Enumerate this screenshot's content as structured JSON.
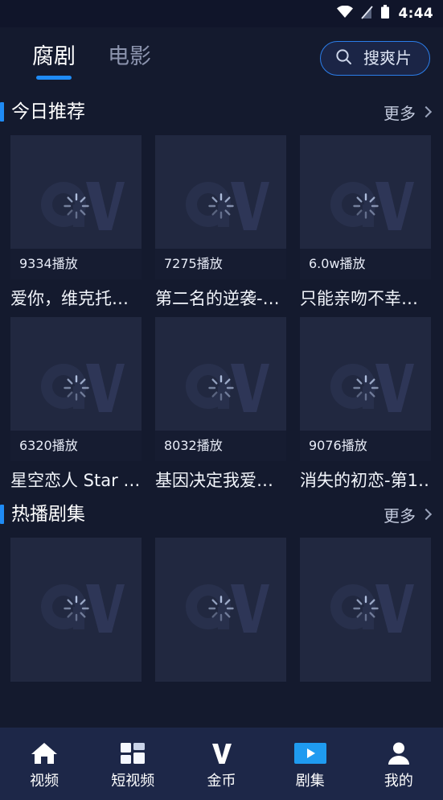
{
  "statusbar": {
    "time": "4:44",
    "icons": [
      "wifi-icon",
      "no-signal-icon",
      "battery-icon"
    ]
  },
  "header": {
    "tabs": [
      {
        "label": "腐剧",
        "active": true
      },
      {
        "label": "电影",
        "active": false
      }
    ],
    "search": {
      "label": "搜爽片",
      "icon": "search-icon",
      "border_color": "#2b7de9"
    }
  },
  "accent_color": "#1f8bf5",
  "sections": [
    {
      "title": "今日推荐",
      "more_label": "更多",
      "cards": [
        {
          "play_count": "9334播放",
          "title": "爱你，维克托…"
        },
        {
          "play_count": "7275播放",
          "title": "第二名的逆袭-…"
        },
        {
          "play_count": "6.0w播放",
          "title": "只能亲吻不幸…"
        },
        {
          "play_count": "6320播放",
          "title": "星空恋人 Star …"
        },
        {
          "play_count": "8032播放",
          "title": "基因决定我爱…"
        },
        {
          "play_count": "9076播放",
          "title": "消失的初恋-第1…"
        }
      ]
    },
    {
      "title": "热播剧集",
      "more_label": "更多",
      "cards": [
        {
          "play_count": "",
          "title": ""
        },
        {
          "play_count": "",
          "title": ""
        },
        {
          "play_count": "",
          "title": ""
        }
      ]
    }
  ],
  "bottomnav": {
    "items": [
      {
        "label": "视频",
        "icon": "home-icon",
        "active": true
      },
      {
        "label": "短视频",
        "icon": "grid-icon",
        "active": false
      },
      {
        "label": "金币",
        "icon": "coin-v-icon",
        "active": false
      },
      {
        "label": "剧集",
        "icon": "play-video-icon",
        "active": false
      },
      {
        "label": "我的",
        "icon": "person-icon",
        "active": false
      }
    ],
    "highlight_color": "#1f9bf0"
  }
}
